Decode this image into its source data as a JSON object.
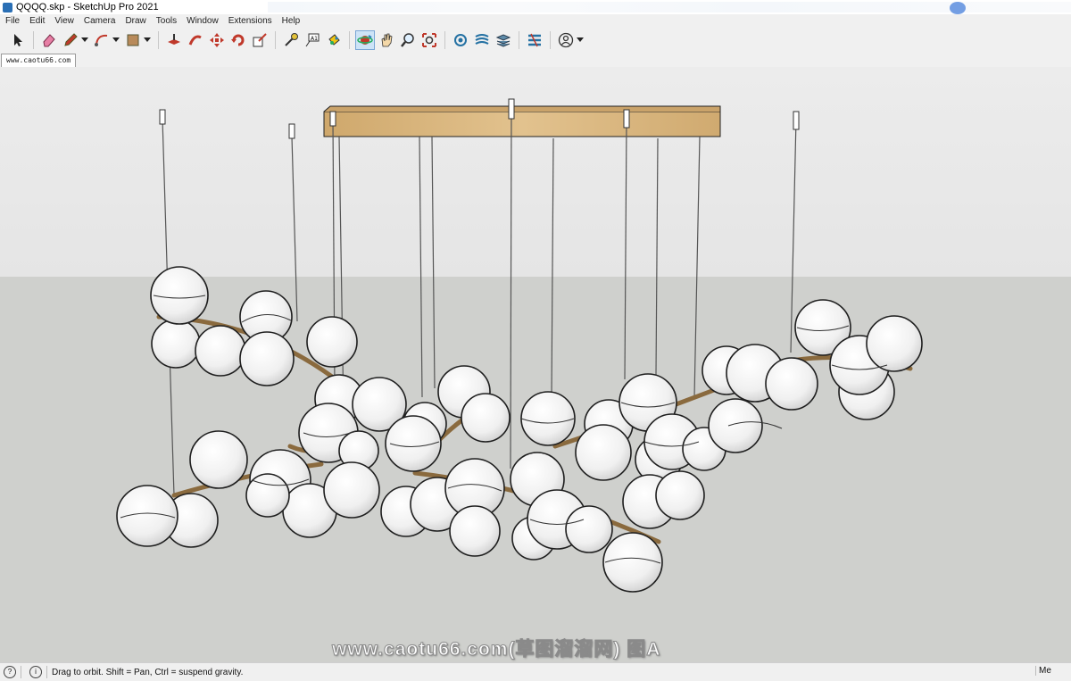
{
  "window": {
    "title": "QQQQ.skp - SketchUp Pro 2021"
  },
  "menu": [
    "File",
    "Edit",
    "View",
    "Camera",
    "Draw",
    "Tools",
    "Window",
    "Extensions",
    "Help"
  ],
  "toolbar": {
    "tools": [
      "select-icon",
      "eraser-icon",
      "pencil-icon",
      "arc-icon",
      "rectangle-icon",
      "push-pull-icon",
      "follow-me-icon",
      "move-icon",
      "rotate-icon",
      "scale-icon",
      "tape-measure-icon",
      "text-icon",
      "paint-bucket-icon",
      "orbit-icon",
      "pan-icon",
      "zoom-icon",
      "zoom-extents-icon",
      "warehouse-icon",
      "extension-warehouse-icon",
      "layout-icon",
      "extension-manager-icon",
      "account-icon"
    ],
    "active_tool": "orbit-icon"
  },
  "scene": {
    "tab_label": "www.caotu66.com"
  },
  "watermark": "www.caotu66.com(草图溜溜网) 图A",
  "status": {
    "message": "Drag to orbit. Shift = Pan, Ctrl = suspend gravity.",
    "right": "Me"
  },
  "colors": {
    "wood": "#d7b47a",
    "rod": "#9a7a4e",
    "globe": "#f2f2f2",
    "ground": "#cfd0cd",
    "sky": "#e8e8e8"
  }
}
